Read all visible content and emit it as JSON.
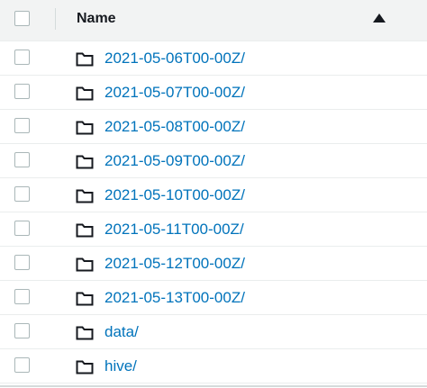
{
  "header": {
    "name_label": "Name",
    "sort_icon": "triangle-up-icon"
  },
  "rows": [
    {
      "label": "2021-05-06T00-00Z/",
      "icon": "folder-icon"
    },
    {
      "label": "2021-05-07T00-00Z/",
      "icon": "folder-icon"
    },
    {
      "label": "2021-05-08T00-00Z/",
      "icon": "folder-icon"
    },
    {
      "label": "2021-05-09T00-00Z/",
      "icon": "folder-icon"
    },
    {
      "label": "2021-05-10T00-00Z/",
      "icon": "folder-icon"
    },
    {
      "label": "2021-05-11T00-00Z/",
      "icon": "folder-icon"
    },
    {
      "label": "2021-05-12T00-00Z/",
      "icon": "folder-icon"
    },
    {
      "label": "2021-05-13T00-00Z/",
      "icon": "folder-icon"
    },
    {
      "label": "data/",
      "icon": "folder-icon"
    },
    {
      "label": "hive/",
      "icon": "folder-icon"
    }
  ],
  "colors": {
    "link": "#0073bb",
    "header_bg": "#f2f3f3",
    "text": "#16191f"
  }
}
